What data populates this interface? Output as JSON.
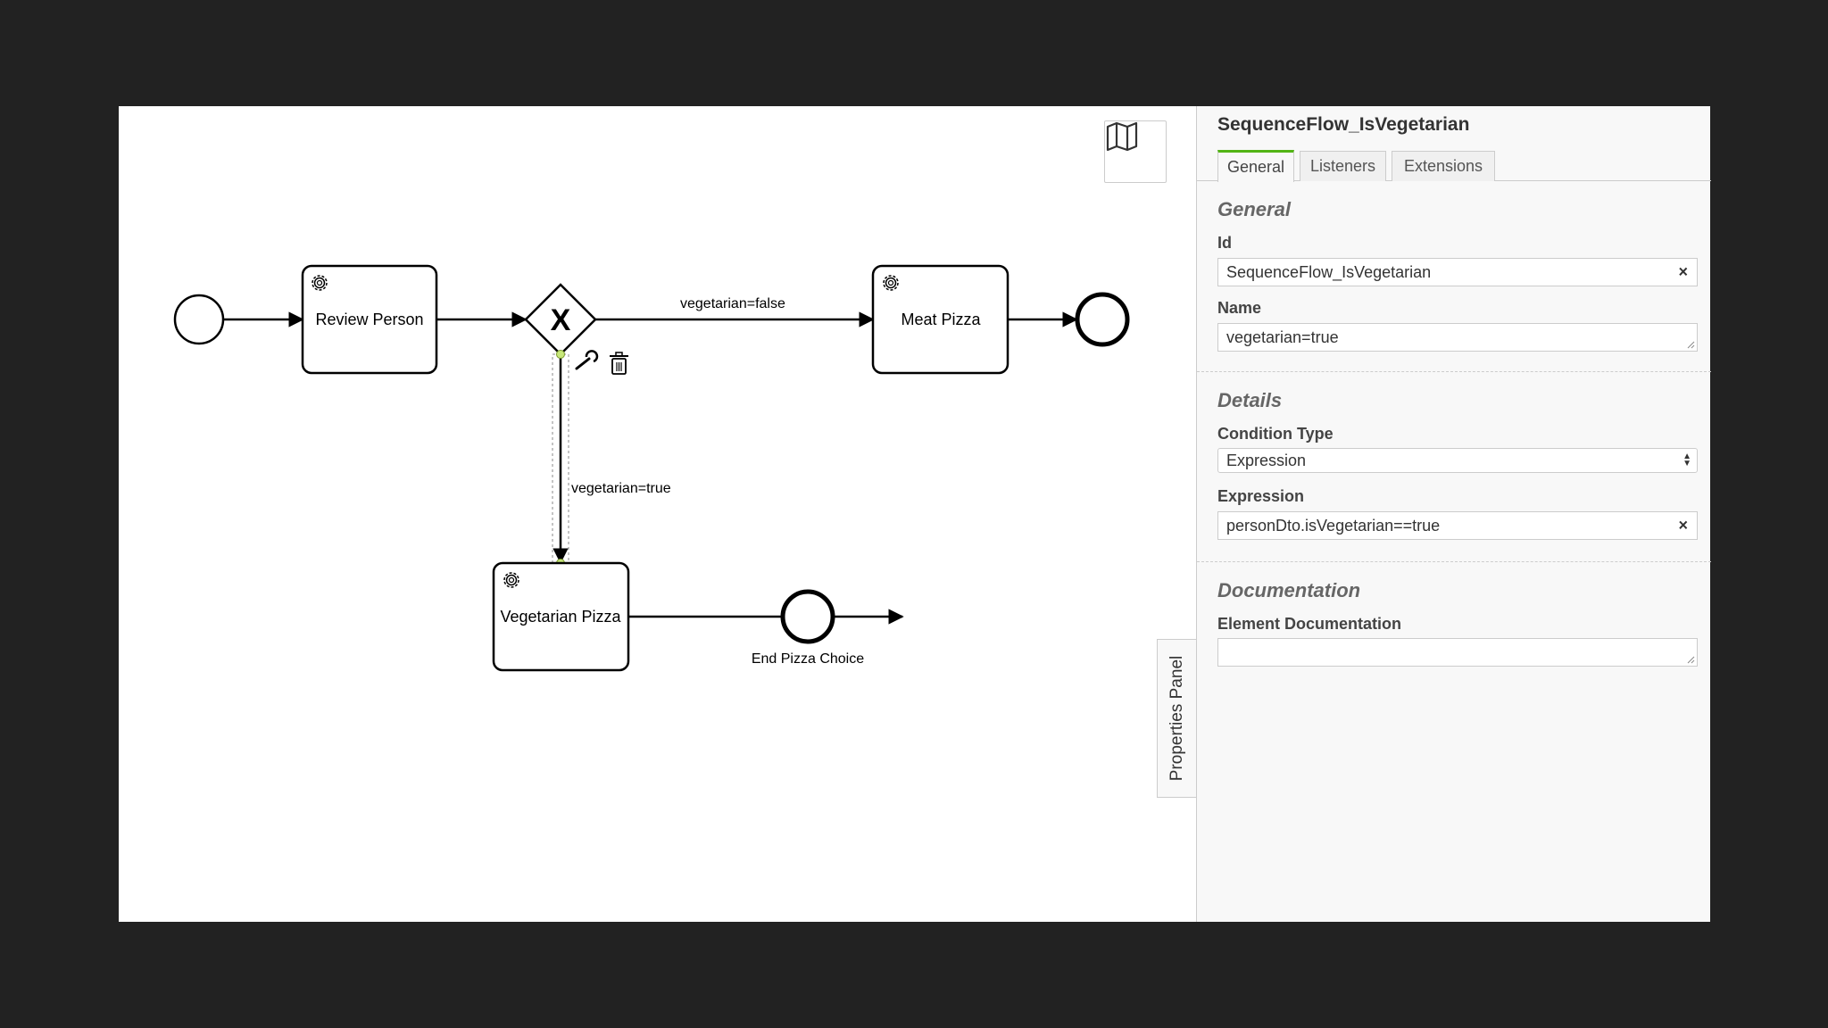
{
  "diagram": {
    "review_person": "Review Person",
    "meat_pizza": "Meat Pizza",
    "vegetarian_pizza": "Vegetarian Pizza",
    "end_pizza_choice": "End Pizza Choice",
    "flow_false_label": "vegetarian=false",
    "flow_true_label": "vegetarian=true",
    "gateway_mark": "X"
  },
  "minimap": {
    "icon": "map-icon"
  },
  "panel_toggle": {
    "label": "Properties Panel"
  },
  "properties": {
    "title": "SequenceFlow_IsVegetarian",
    "tabs": [
      {
        "label": "General",
        "active": true
      },
      {
        "label": "Listeners",
        "active": false
      },
      {
        "label": "Extensions",
        "active": false
      }
    ],
    "general": {
      "heading": "General",
      "id_label": "Id",
      "id_value": "SequenceFlow_IsVegetarian",
      "name_label": "Name",
      "name_value": "vegetarian=true"
    },
    "details": {
      "heading": "Details",
      "condition_type_label": "Condition Type",
      "condition_type_value": "Expression",
      "expression_label": "Expression",
      "expression_value": "personDto.isVegetarian==true"
    },
    "documentation": {
      "heading": "Documentation",
      "element_doc_label": "Element Documentation",
      "element_doc_value": ""
    },
    "clear_glyph": "×",
    "accent_color": "#52b415"
  }
}
